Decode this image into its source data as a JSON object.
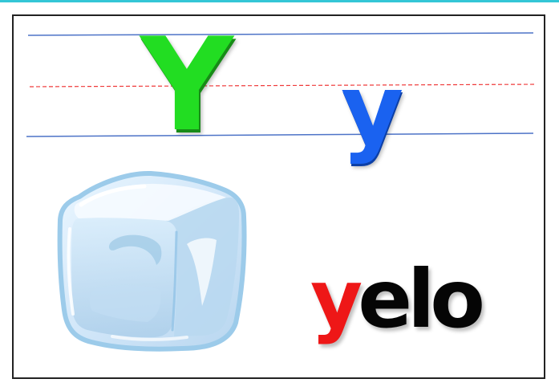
{
  "card": {
    "uppercase_letter": "Y",
    "lowercase_letter": "y",
    "word_first_letter": "y",
    "word_rest": "elo",
    "accent_color": "#34c6d6",
    "uppercase_color": "#22dd22",
    "lowercase_color": "#1a62f0",
    "word_first_color": "#ee1717",
    "word_rest_color": "#050505",
    "image": "ice-cube-icon"
  }
}
